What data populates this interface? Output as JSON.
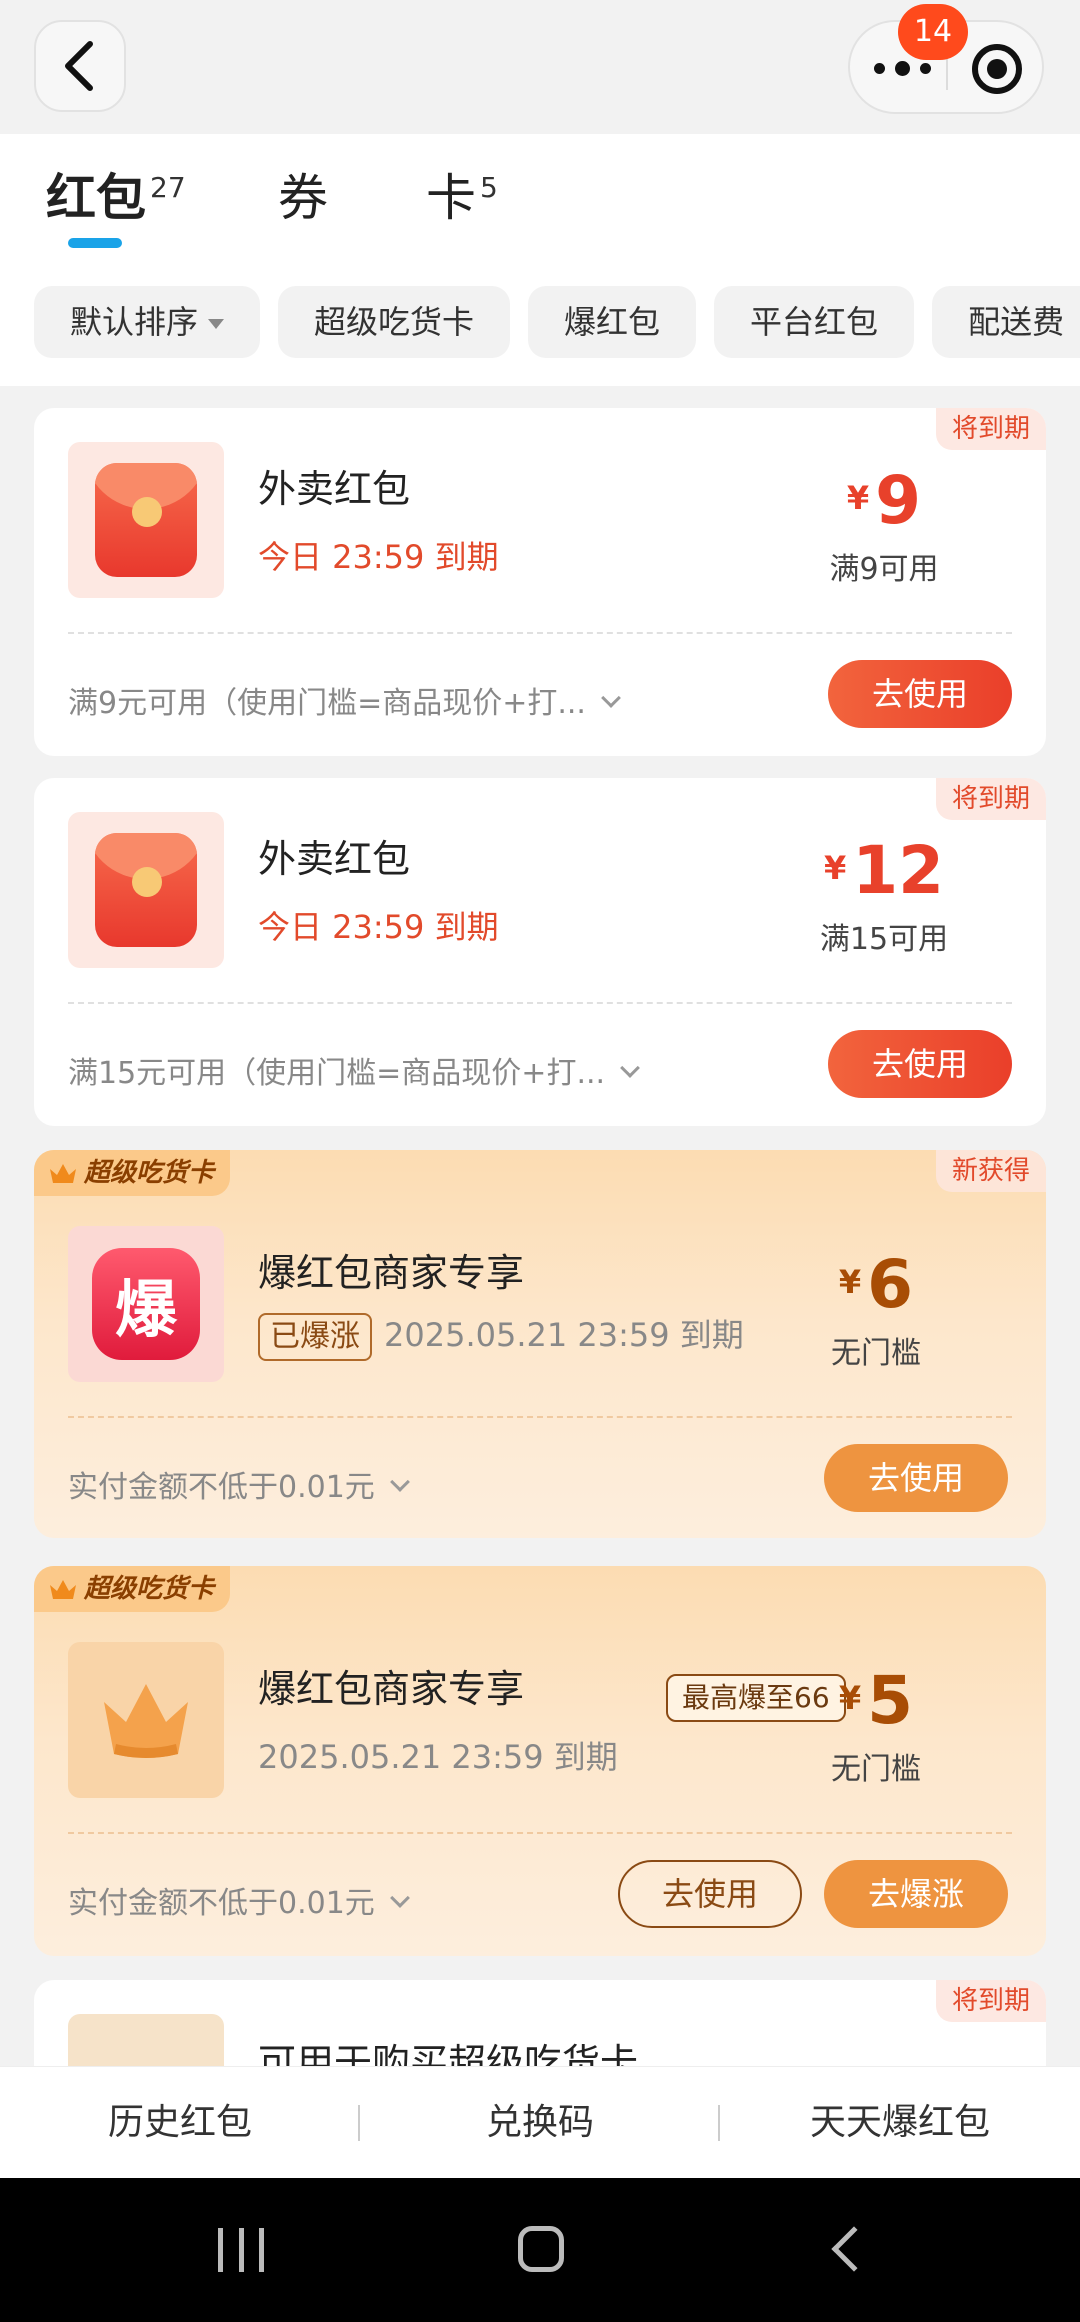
{
  "header": {
    "notification_count": "14"
  },
  "tabs": [
    {
      "label": "红包",
      "count": "27",
      "active": true
    },
    {
      "label": "券",
      "count": "",
      "active": false
    },
    {
      "label": "卡",
      "count": "5",
      "active": false
    }
  ],
  "filters": [
    "默认排序",
    "超级吃货卡",
    "爆红包",
    "平台红包",
    "配送费"
  ],
  "cards": [
    {
      "corner_tag": "将到期",
      "title": "外卖红包",
      "expire": "今日 23:59 到期",
      "currency": "¥",
      "amount": "9",
      "condition": "满9可用",
      "description": "满9元可用（使用门槛=商品现价+打...",
      "button": "去使用"
    },
    {
      "corner_tag": "将到期",
      "title": "外卖红包",
      "expire": "今日 23:59 到期",
      "currency": "¥",
      "amount": "12",
      "condition": "满15可用",
      "description": "满15元可用（使用门槛=商品现价+打...",
      "button": "去使用"
    },
    {
      "super_tag": "超级吃货卡",
      "corner_tag": "新获得",
      "icon_text": "爆",
      "title": "爆红包商家专享",
      "status_tag": "已爆涨",
      "expire": "2025.05.21 23:59 到期",
      "currency": "¥",
      "amount": "6",
      "condition": "无门槛",
      "description": "实付金额不低于0.01元",
      "button": "去使用"
    },
    {
      "super_tag": "超级吃货卡",
      "title": "爆红包商家专享",
      "max_tag": "最高爆至66",
      "expire": "2025.05.21 23:59 到期",
      "currency": "¥",
      "amount": "5",
      "condition": "无门槛",
      "description": "实付金额不低于0.01元",
      "button_outline": "去使用",
      "button": "去爆涨"
    },
    {
      "corner_tag": "将到期",
      "title": "可用于购买超级吃货卡"
    }
  ],
  "bottom_bar": [
    "历史红包",
    "兑换码",
    "天天爆红包"
  ],
  "colors": {
    "accent_red": "#e8412b",
    "tab_indicator": "#1aa3e8",
    "gold_card": "#fde7cc",
    "orange_button": "#ee9440"
  }
}
